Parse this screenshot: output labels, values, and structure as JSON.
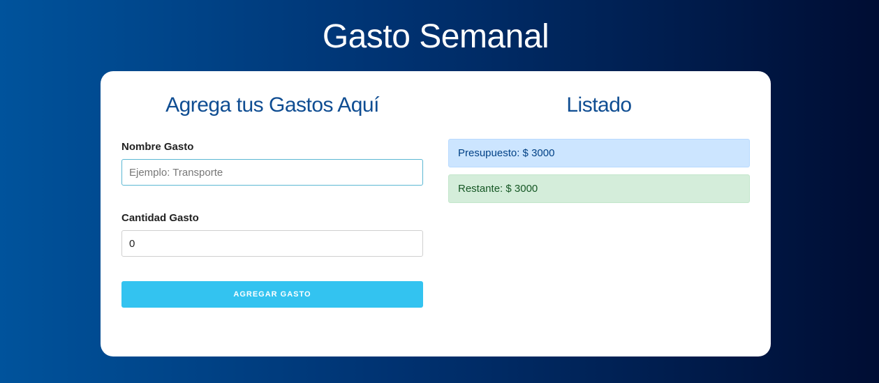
{
  "header": {
    "title": "Gasto Semanal"
  },
  "form": {
    "title": "Agrega tus Gastos Aquí",
    "name_label": "Nombre Gasto",
    "name_placeholder": "Ejemplo: Transporte",
    "name_value": "",
    "quantity_label": "Cantidad Gasto",
    "quantity_value": "0",
    "submit_label": "Agregar Gasto"
  },
  "listing": {
    "title": "Listado",
    "budget_text": "Presupuesto: $ 3000",
    "remaining_text": "Restante: $ 3000"
  },
  "colors": {
    "background_start": "#00539c",
    "background_end": "#000d33",
    "accent_title": "#0f4d92",
    "button": "#33c3f0",
    "budget_alert": "#cce5ff",
    "remaining_alert": "#d4edda"
  }
}
